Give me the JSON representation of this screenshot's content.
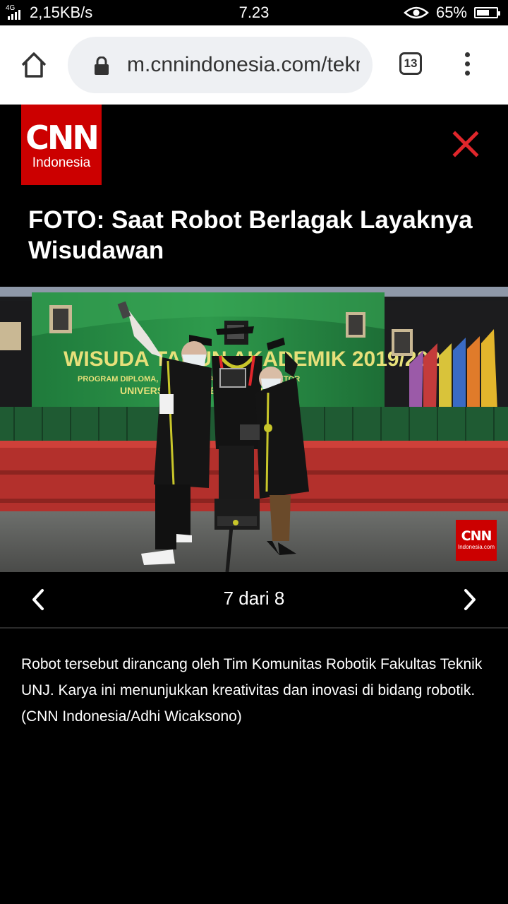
{
  "status_bar": {
    "network_type": "4G",
    "speed": "2,15KB/s",
    "time": "7.23",
    "battery": "65%",
    "battery_level": 0.65
  },
  "browser": {
    "url": "m.cnnindonesia.com/teknologi",
    "tab_count": "13"
  },
  "header": {
    "logo_text": "CNN",
    "logo_sub": "Indonesia"
  },
  "article": {
    "title": "FOTO: Saat Robot Berlagak Layaknya Wisudawan",
    "photo_banner_text": "WISUDA TAHUN AKADEMIK 2019/2020",
    "photo_banner_sub": "PROGRAM DIPLOMA, SARJANA, MAGISTER, DAN DOKTOR",
    "photo_banner_univ": "UNIVERSITAS NEGERI JAKARTA",
    "watermark_text": "CNN",
    "watermark_sub": "Indonesia.com",
    "pager": {
      "counter": "7 dari 8"
    },
    "caption": "Robot tersebut dirancang oleh Tim Komunitas Robotik Fakultas Teknik UNJ. Karya ini menunjukkan kreativitas dan inovasi di bidang robotik. (CNN Indonesia/Adhi Wicaksono)"
  },
  "colors": {
    "brand_red": "#cc0000",
    "background": "#000000",
    "close_red": "#e0262b"
  }
}
